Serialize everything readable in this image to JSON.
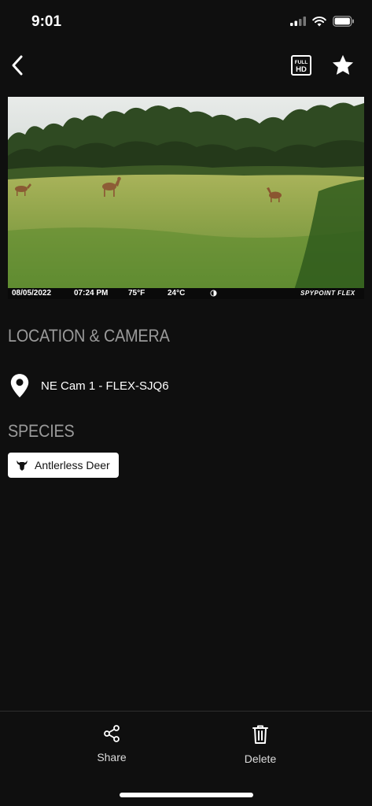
{
  "status_bar": {
    "time": "9:01",
    "icons": [
      "cellular-signal-icon",
      "wifi-icon",
      "battery-icon"
    ]
  },
  "nav": {
    "back_icon": "chevron-left-icon",
    "fullhd_icon": "full-hd-icon",
    "fullhd_text_line1": "FULL",
    "fullhd_text_line2": "HD",
    "favorite_icon": "star-icon"
  },
  "photo": {
    "caption": {
      "date": "08/05/2022",
      "time": "07:24 PM",
      "temp_f": "75°F",
      "temp_c": "24°C",
      "moon_icon": "moon-phase-icon",
      "brand": "SPYPOINT FLEX"
    }
  },
  "location_section": {
    "title": "LOCATION & CAMERA",
    "icon": "location-pin-icon",
    "camera_name": "NE Cam 1 - FLEX-SJQ6"
  },
  "species_section": {
    "title": "SPECIES",
    "chips": [
      {
        "icon": "deer-head-icon",
        "label": "Antlerless Deer"
      }
    ]
  },
  "actions": {
    "share": {
      "icon": "share-icon",
      "label": "Share"
    },
    "delete": {
      "icon": "trash-icon",
      "label": "Delete"
    }
  },
  "colors": {
    "background": "#0f0f0f",
    "section_title": "#9a9a9a",
    "chip_background": "#ffffff"
  }
}
